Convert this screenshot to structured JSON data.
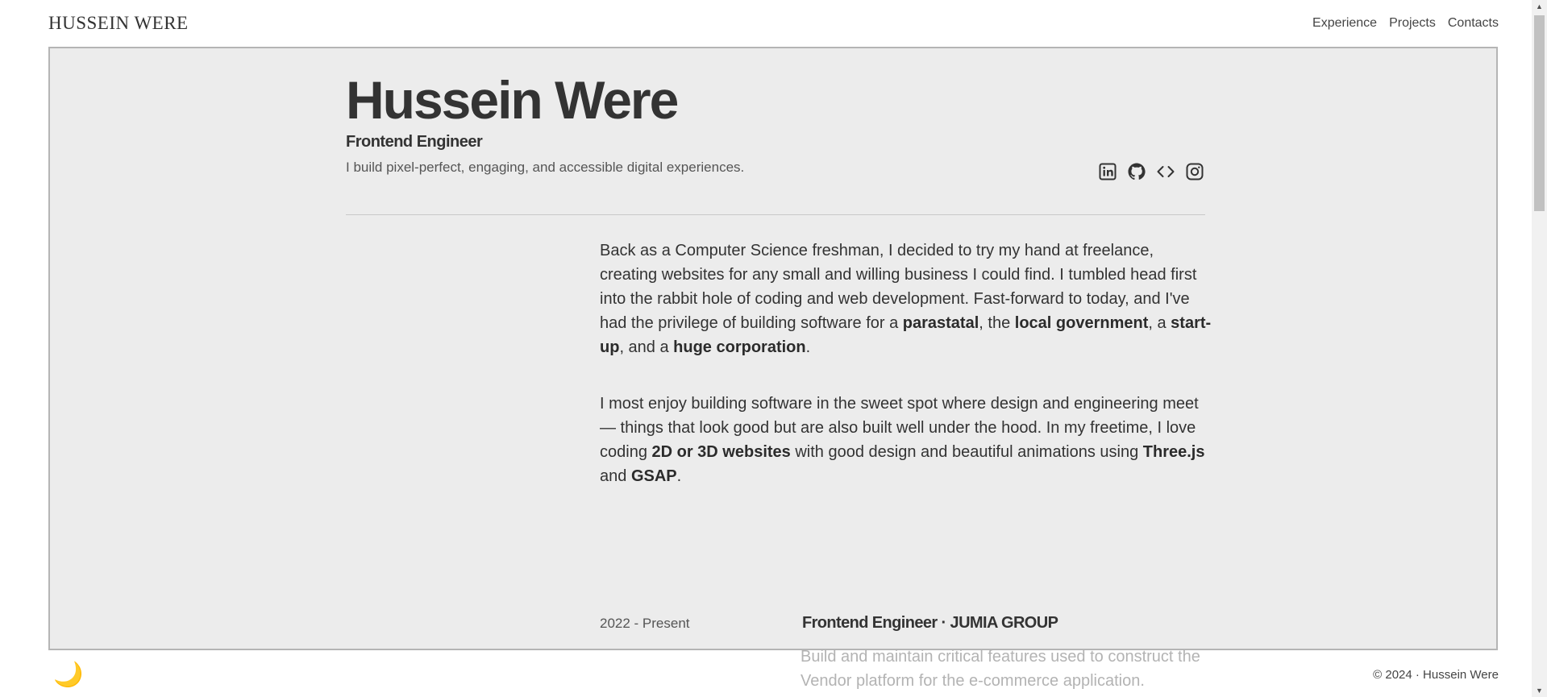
{
  "header": {
    "brand": "HUSSEIN WERE",
    "nav": [
      "Experience",
      "Projects",
      "Contacts"
    ]
  },
  "hero": {
    "name": "Hussein Were",
    "role": "Frontend Engineer",
    "tagline": "I build pixel-perfect, engaging, and accessible digital experiences.",
    "socials": [
      "linkedin-icon",
      "github-icon",
      "code-icon",
      "instagram-icon"
    ]
  },
  "about": {
    "p1": [
      {
        "t": "Back as a Computer Science freshman, I decided to try my hand at freelance, creating websites for any small and willing business I could find. I tumbled head first into the rabbit hole of coding and web development. Fast-forward to today, and I've had the privilege of building software for a "
      },
      {
        "t": "parastatal",
        "b": true
      },
      {
        "t": ", the "
      },
      {
        "t": "local government",
        "b": true
      },
      {
        "t": ", a "
      },
      {
        "t": "start-up",
        "b": true
      },
      {
        "t": ", and a "
      },
      {
        "t": "huge corporation",
        "b": true
      },
      {
        "t": "."
      }
    ],
    "p2": [
      {
        "t": "I most enjoy building software in the sweet spot where design and engineering meet — things that look good but are also built well under the hood. In my freetime, I love coding "
      },
      {
        "t": "2D or 3D websites",
        "b": true
      },
      {
        "t": " with good design and beautiful animations using "
      },
      {
        "t": "Three.js",
        "b": true
      },
      {
        "t": " and "
      },
      {
        "t": "GSAP",
        "b": true
      },
      {
        "t": "."
      }
    ]
  },
  "experience": {
    "date": "2022 - Present",
    "title": "Frontend Engineer · JUMIA GROUP",
    "description": "Build and maintain critical features used to construct the Vendor platform for the e-commerce application."
  },
  "theme_toggle": "🌙",
  "footer": "© 2024 · Hussein Were"
}
